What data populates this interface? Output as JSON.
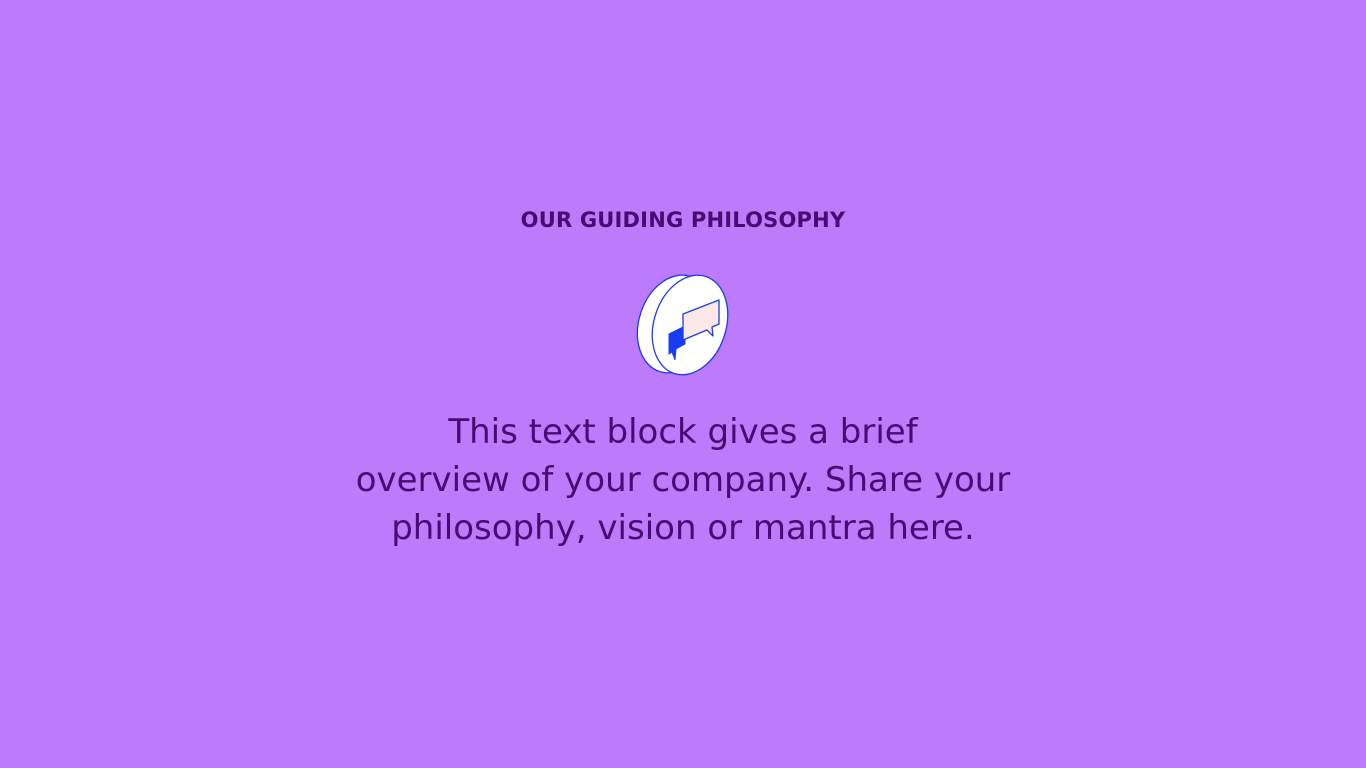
{
  "section": {
    "eyebrow": "OUR GUIDING PHILOSOPHY",
    "icon": "speech-bubbles-icon",
    "body_lines": [
      "This text block gives a brief",
      "overview of your company. Share your",
      "philosophy, vision or mantra here."
    ]
  },
  "colors": {
    "background": "#bc7bfb",
    "text": "#4a0a72",
    "icon_outline": "#1a3cf0",
    "icon_face": "#ffffff",
    "bubble_front": "#fde8e8",
    "bubble_back": "#1a3cf0"
  }
}
